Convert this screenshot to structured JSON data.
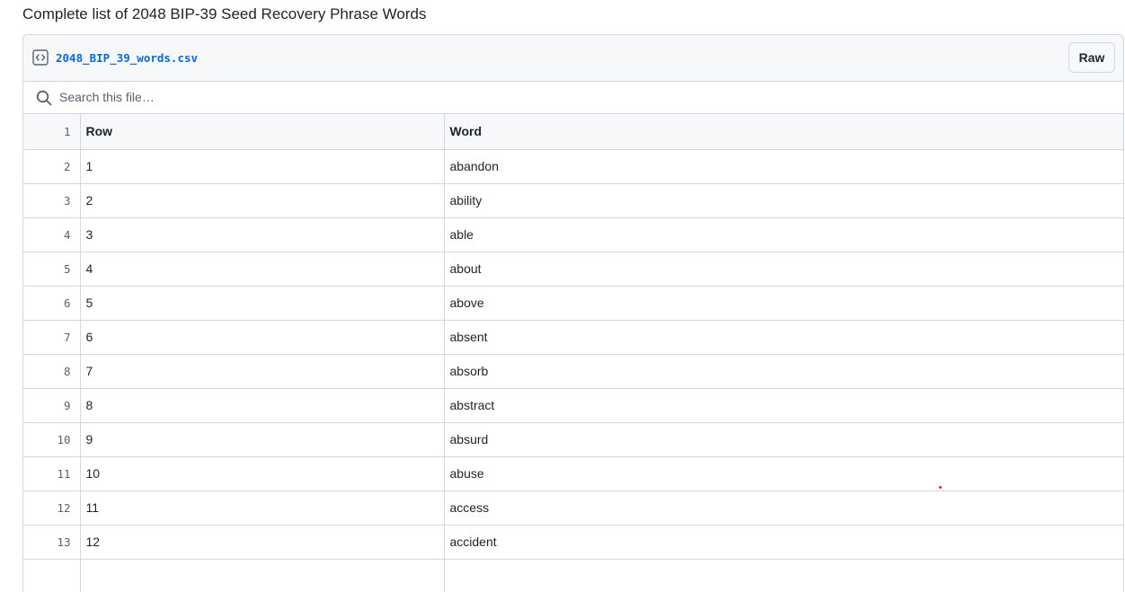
{
  "page_title": "Complete list of 2048 BIP-39 Seed Recovery Phrase Words",
  "file": {
    "name": "2048_BIP_39_words.csv",
    "icon": "code-icon",
    "raw_label": "Raw"
  },
  "search": {
    "icon": "search-icon",
    "placeholder": "Search this file…"
  },
  "table": {
    "header_line": "1",
    "columns": [
      "Row",
      "Word"
    ],
    "rows": [
      {
        "line": "2",
        "row": "1",
        "word": "abandon"
      },
      {
        "line": "3",
        "row": "2",
        "word": "ability"
      },
      {
        "line": "4",
        "row": "3",
        "word": "able"
      },
      {
        "line": "5",
        "row": "4",
        "word": "about"
      },
      {
        "line": "6",
        "row": "5",
        "word": "above"
      },
      {
        "line": "7",
        "row": "6",
        "word": "absent"
      },
      {
        "line": "8",
        "row": "7",
        "word": "absorb"
      },
      {
        "line": "9",
        "row": "8",
        "word": "abstract"
      },
      {
        "line": "10",
        "row": "9",
        "word": "absurd"
      },
      {
        "line": "11",
        "row": "10",
        "word": "abuse"
      },
      {
        "line": "12",
        "row": "11",
        "word": "access"
      },
      {
        "line": "13",
        "row": "12",
        "word": "accident"
      },
      {
        "line": "",
        "row": "",
        "word": ""
      }
    ]
  },
  "colors": {
    "link": "#0969da",
    "border": "#d0d7de",
    "header_bg": "#f6f8fa",
    "marker": "#e0201b"
  }
}
